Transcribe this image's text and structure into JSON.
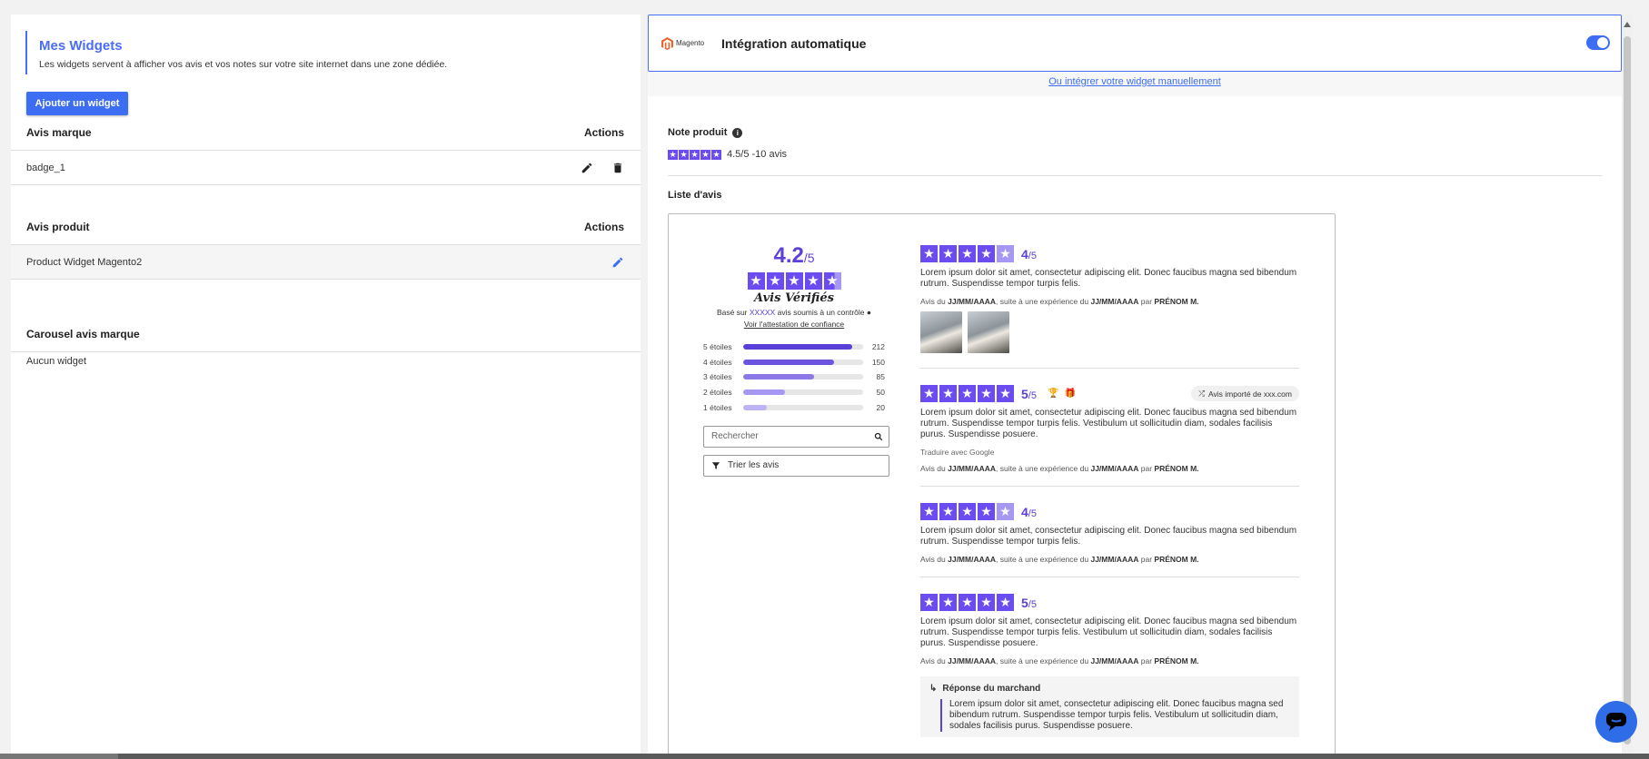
{
  "widgets": {
    "title": "Mes Widgets",
    "description": "Les widgets servent à afficher vos avis et vos notes sur votre site internet dans une zone dédiée.",
    "add_button": "Ajouter un widget",
    "sections": [
      {
        "title": "Avis marque",
        "actions_label": "Actions",
        "items": [
          {
            "name": "badge_1"
          }
        ]
      },
      {
        "title": "Avis produit",
        "actions_label": "Actions",
        "items": [
          {
            "name": "Product Widget Magento2"
          }
        ]
      },
      {
        "title": "Carousel avis marque",
        "empty_text": "Aucun widget"
      }
    ]
  },
  "integration": {
    "logo_text": "Magento",
    "title": "Intégration automatique",
    "toggle_on": true,
    "manual_link": "Ou intégrer votre widget manuellement"
  },
  "preview": {
    "note_label": "Note produit",
    "note_value": "4.5/5 -10 avis",
    "list_label": "Liste d'avis",
    "summary": {
      "score": "4.2",
      "score_max": "/5",
      "brand_text": "Avis Vérifiés",
      "based_prefix": "Basé sur",
      "based_count": "XXXXX",
      "based_suffix": "avis soumis à un contrôle",
      "attestation_link": "Voir l'attestation de confiance",
      "distribution": [
        {
          "label": "5 étoiles",
          "count": "212",
          "fraction": 0.91,
          "color": "#5b3fd9"
        },
        {
          "label": "4 étoiles",
          "count": "150",
          "fraction": 0.76,
          "color": "#6d54e0"
        },
        {
          "label": "3 étoiles",
          "count": "85",
          "fraction": 0.59,
          "color": "#8c78e6"
        },
        {
          "label": "2 étoiles",
          "count": "50",
          "fraction": 0.35,
          "color": "#a597f2"
        },
        {
          "label": "1 étoiles",
          "count": "20",
          "fraction": 0.2,
          "color": "#bdb3f5"
        }
      ],
      "search_placeholder": "Rechercher",
      "sort_label": "Trier les avis"
    },
    "reviews": [
      {
        "score": "4",
        "score_max": "/5",
        "text": "Lorem ipsum dolor sit amet, consectetur adipiscing elit. Donec faucibus magna sed bibendum rutrum. Suspendisse tempor turpis felis.",
        "meta_prefix": "Avis du",
        "meta_date1": "JJ/MM/AAAA",
        "meta_mid": ", suite à une expérience du",
        "meta_date2": "JJ/MM/AAAA",
        "meta_by": "par",
        "meta_author": "PRÉNOM M."
      },
      {
        "score": "5",
        "score_max": "/5",
        "imported": "Avis importé de xxx.com",
        "text": "Lorem ipsum dolor sit amet, consectetur adipiscing elit. Donec faucibus magna sed bibendum rutrum. Suspendisse tempor turpis felis. Vestibulum ut sollicitudin diam, sodales facilisis purus. Suspendisse posuere.",
        "translate": "Traduire avec Google",
        "meta_prefix": "Avis du",
        "meta_date1": "JJ/MM/AAAA",
        "meta_mid": ", suite à une expérience du",
        "meta_date2": "JJ/MM/AAAA",
        "meta_by": "par",
        "meta_author": "PRÉNOM M."
      },
      {
        "score": "4",
        "score_max": "/5",
        "text": "Lorem ipsum dolor sit amet, consectetur adipiscing elit. Donec faucibus magna sed bibendum rutrum. Suspendisse tempor turpis felis.",
        "meta_prefix": "Avis du",
        "meta_date1": "JJ/MM/AAAA",
        "meta_mid": ", suite à une expérience du",
        "meta_date2": "JJ/MM/AAAA",
        "meta_by": "par",
        "meta_author": "PRÉNOM M."
      },
      {
        "score": "5",
        "score_max": "/5",
        "text": "Lorem ipsum dolor sit amet, consectetur adipiscing elit. Donec faucibus magna sed bibendum rutrum. Suspendisse tempor turpis felis. Vestibulum ut sollicitudin diam, sodales facilisis purus. Suspendisse posuere.",
        "meta_prefix": "Avis du",
        "meta_date1": "JJ/MM/AAAA",
        "meta_mid": ", suite à une expérience du",
        "meta_date2": "JJ/MM/AAAA",
        "meta_by": "par",
        "meta_author": "PRÉNOM M.",
        "merchant_title": "Réponse du marchand",
        "merchant_text": "Lorem ipsum dolor sit amet, consectetur adipiscing elit. Donec faucibus magna sed bibendum rutrum. Suspendisse tempor turpis felis. Vestibulum ut sollicitudin diam, sodales facilisis purus. Suspendisse posuere."
      }
    ]
  },
  "colors": {
    "accent": "#3d6df2",
    "star": "#6a4cf0",
    "star_light": "#a597f2"
  }
}
